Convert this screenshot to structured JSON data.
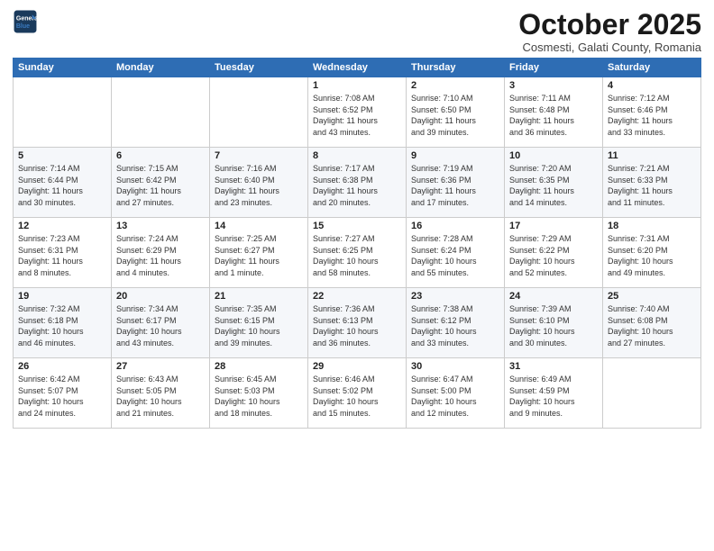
{
  "logo": {
    "line1": "General",
    "line2": "Blue"
  },
  "title": "October 2025",
  "subtitle": "Cosmesti, Galati County, Romania",
  "weekdays": [
    "Sunday",
    "Monday",
    "Tuesday",
    "Wednesday",
    "Thursday",
    "Friday",
    "Saturday"
  ],
  "weeks": [
    [
      {
        "day": "",
        "info": ""
      },
      {
        "day": "",
        "info": ""
      },
      {
        "day": "",
        "info": ""
      },
      {
        "day": "1",
        "info": "Sunrise: 7:08 AM\nSunset: 6:52 PM\nDaylight: 11 hours\nand 43 minutes."
      },
      {
        "day": "2",
        "info": "Sunrise: 7:10 AM\nSunset: 6:50 PM\nDaylight: 11 hours\nand 39 minutes."
      },
      {
        "day": "3",
        "info": "Sunrise: 7:11 AM\nSunset: 6:48 PM\nDaylight: 11 hours\nand 36 minutes."
      },
      {
        "day": "4",
        "info": "Sunrise: 7:12 AM\nSunset: 6:46 PM\nDaylight: 11 hours\nand 33 minutes."
      }
    ],
    [
      {
        "day": "5",
        "info": "Sunrise: 7:14 AM\nSunset: 6:44 PM\nDaylight: 11 hours\nand 30 minutes."
      },
      {
        "day": "6",
        "info": "Sunrise: 7:15 AM\nSunset: 6:42 PM\nDaylight: 11 hours\nand 27 minutes."
      },
      {
        "day": "7",
        "info": "Sunrise: 7:16 AM\nSunset: 6:40 PM\nDaylight: 11 hours\nand 23 minutes."
      },
      {
        "day": "8",
        "info": "Sunrise: 7:17 AM\nSunset: 6:38 PM\nDaylight: 11 hours\nand 20 minutes."
      },
      {
        "day": "9",
        "info": "Sunrise: 7:19 AM\nSunset: 6:36 PM\nDaylight: 11 hours\nand 17 minutes."
      },
      {
        "day": "10",
        "info": "Sunrise: 7:20 AM\nSunset: 6:35 PM\nDaylight: 11 hours\nand 14 minutes."
      },
      {
        "day": "11",
        "info": "Sunrise: 7:21 AM\nSunset: 6:33 PM\nDaylight: 11 hours\nand 11 minutes."
      }
    ],
    [
      {
        "day": "12",
        "info": "Sunrise: 7:23 AM\nSunset: 6:31 PM\nDaylight: 11 hours\nand 8 minutes."
      },
      {
        "day": "13",
        "info": "Sunrise: 7:24 AM\nSunset: 6:29 PM\nDaylight: 11 hours\nand 4 minutes."
      },
      {
        "day": "14",
        "info": "Sunrise: 7:25 AM\nSunset: 6:27 PM\nDaylight: 11 hours\nand 1 minute."
      },
      {
        "day": "15",
        "info": "Sunrise: 7:27 AM\nSunset: 6:25 PM\nDaylight: 10 hours\nand 58 minutes."
      },
      {
        "day": "16",
        "info": "Sunrise: 7:28 AM\nSunset: 6:24 PM\nDaylight: 10 hours\nand 55 minutes."
      },
      {
        "day": "17",
        "info": "Sunrise: 7:29 AM\nSunset: 6:22 PM\nDaylight: 10 hours\nand 52 minutes."
      },
      {
        "day": "18",
        "info": "Sunrise: 7:31 AM\nSunset: 6:20 PM\nDaylight: 10 hours\nand 49 minutes."
      }
    ],
    [
      {
        "day": "19",
        "info": "Sunrise: 7:32 AM\nSunset: 6:18 PM\nDaylight: 10 hours\nand 46 minutes."
      },
      {
        "day": "20",
        "info": "Sunrise: 7:34 AM\nSunset: 6:17 PM\nDaylight: 10 hours\nand 43 minutes."
      },
      {
        "day": "21",
        "info": "Sunrise: 7:35 AM\nSunset: 6:15 PM\nDaylight: 10 hours\nand 39 minutes."
      },
      {
        "day": "22",
        "info": "Sunrise: 7:36 AM\nSunset: 6:13 PM\nDaylight: 10 hours\nand 36 minutes."
      },
      {
        "day": "23",
        "info": "Sunrise: 7:38 AM\nSunset: 6:12 PM\nDaylight: 10 hours\nand 33 minutes."
      },
      {
        "day": "24",
        "info": "Sunrise: 7:39 AM\nSunset: 6:10 PM\nDaylight: 10 hours\nand 30 minutes."
      },
      {
        "day": "25",
        "info": "Sunrise: 7:40 AM\nSunset: 6:08 PM\nDaylight: 10 hours\nand 27 minutes."
      }
    ],
    [
      {
        "day": "26",
        "info": "Sunrise: 6:42 AM\nSunset: 5:07 PM\nDaylight: 10 hours\nand 24 minutes."
      },
      {
        "day": "27",
        "info": "Sunrise: 6:43 AM\nSunset: 5:05 PM\nDaylight: 10 hours\nand 21 minutes."
      },
      {
        "day": "28",
        "info": "Sunrise: 6:45 AM\nSunset: 5:03 PM\nDaylight: 10 hours\nand 18 minutes."
      },
      {
        "day": "29",
        "info": "Sunrise: 6:46 AM\nSunset: 5:02 PM\nDaylight: 10 hours\nand 15 minutes."
      },
      {
        "day": "30",
        "info": "Sunrise: 6:47 AM\nSunset: 5:00 PM\nDaylight: 10 hours\nand 12 minutes."
      },
      {
        "day": "31",
        "info": "Sunrise: 6:49 AM\nSunset: 4:59 PM\nDaylight: 10 hours\nand 9 minutes."
      },
      {
        "day": "",
        "info": ""
      }
    ]
  ]
}
